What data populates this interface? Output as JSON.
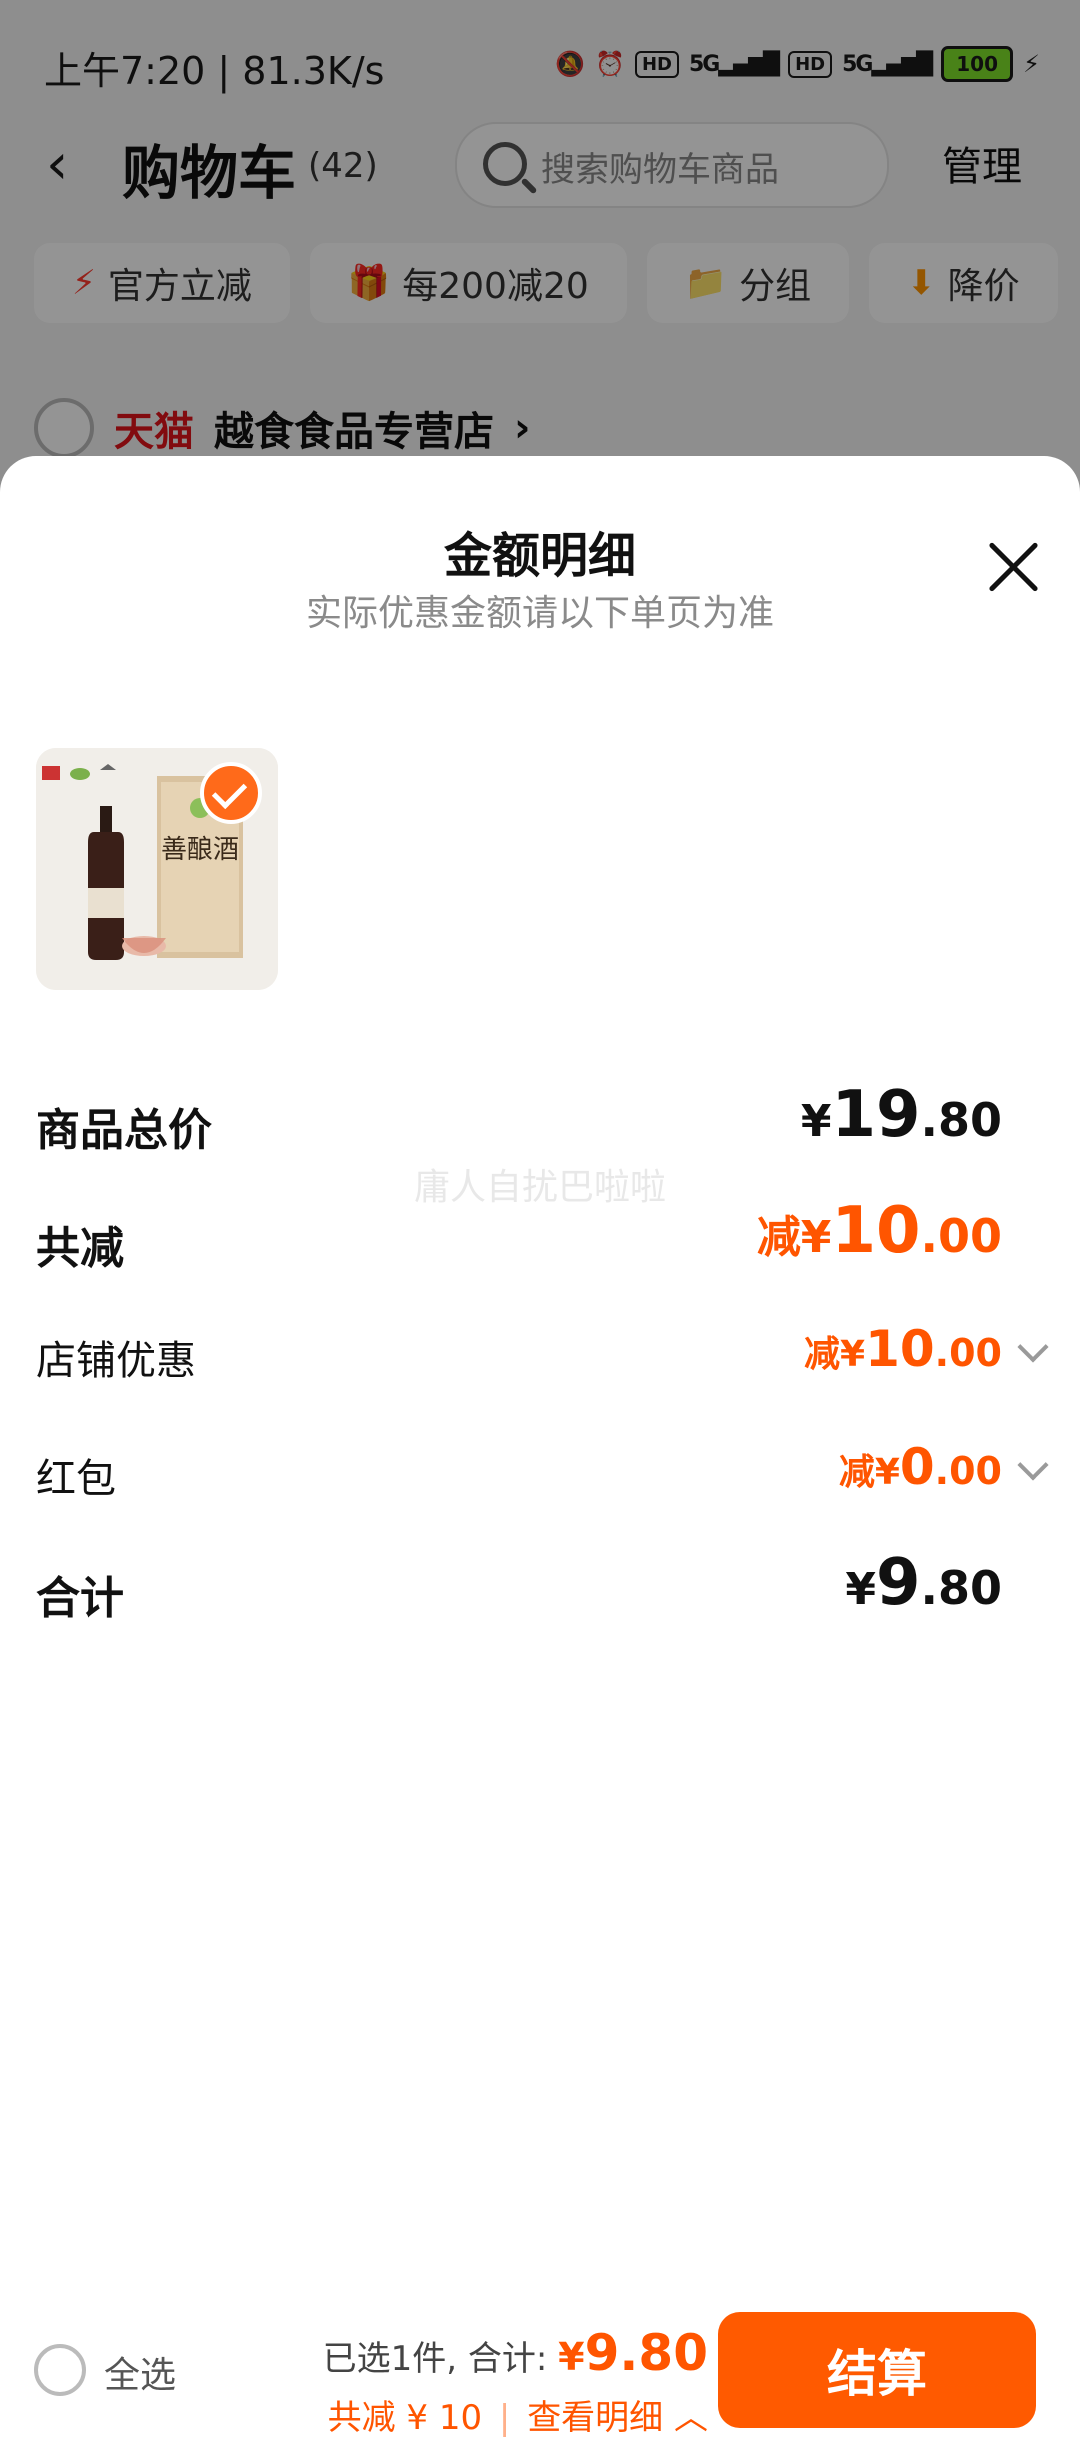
{
  "status_bar": {
    "time_speed": "上午7:20 | 81.3K/s",
    "hd1": "HD",
    "net1": "5G",
    "hd2": "HD",
    "net2": "5G",
    "battery": "100"
  },
  "header": {
    "title": "购物车",
    "count": "(42)",
    "search_placeholder": "搜索购物车商品",
    "manage": "管理"
  },
  "chips": [
    {
      "icon": "lightning-icon",
      "label": "官方立减"
    },
    {
      "icon": "gift-icon",
      "label": "每200减20"
    },
    {
      "icon": "folder-icon",
      "label": "分组"
    },
    {
      "icon": "down-arrow-icon",
      "label": "降价"
    }
  ],
  "store": {
    "platform": "天猫",
    "name": "越食食品专营店",
    "chevron": "›"
  },
  "sheet": {
    "title": "金额明细",
    "subtitle": "实际优惠金额请以下单页为准",
    "product_label": "善酿酒",
    "watermark": "庸人自扰巴啦啦",
    "rows": {
      "total_price": {
        "label": "商品总价",
        "sym": "¥",
        "int": "19",
        "dec": ".80"
      },
      "total_discount": {
        "label": "共减",
        "prefix": "减¥",
        "int": "10",
        "dec": ".00"
      },
      "store_discount": {
        "label": "店铺优惠",
        "prefix": "减¥",
        "int": "10",
        "dec": ".00"
      },
      "red_packet": {
        "label": "红包",
        "prefix": "减¥",
        "int": "0",
        "dec": ".00"
      },
      "sum": {
        "label": "合计",
        "sym": "¥",
        "int": "9",
        "dec": ".80"
      }
    }
  },
  "bottom": {
    "select_all": "全选",
    "selected_text": "已选1件, 合计:",
    "sum_sym": "¥",
    "sum_value": "9.80",
    "discount_text": "共减 ¥ 10",
    "details_text": "查看明细",
    "checkout": "结算"
  },
  "colors": {
    "accent": "#ff5500",
    "checkout_bg": "#ff5a00",
    "tmall": "#e1141b"
  }
}
